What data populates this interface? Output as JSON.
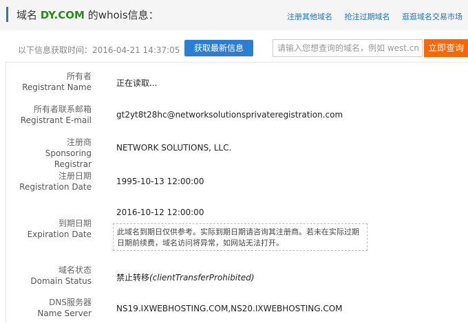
{
  "header": {
    "title_prefix": "域名",
    "domain": "DY.COM",
    "title_suffix": "的whois信息：",
    "links": [
      "注册其他域名",
      "抢注过期域名",
      "逛逛域名交易市场"
    ]
  },
  "toolbar": {
    "fetch_time": "以下信息获取时间：2016-04-21 14:37:05",
    "refresh_label": "获取最新信息",
    "search_placeholder": "请输入您想查询的域名，例如 west.cn",
    "search_button": "立即查询"
  },
  "records": {
    "registrant": {
      "cn": "所有者",
      "en": "Registrant Name",
      "value": "正在读取..."
    },
    "email": {
      "cn": "所有者联系邮箱",
      "en": "Registrant E-mail",
      "value": "gt2yt8t28hc@networksolutionsprivateregistration.com"
    },
    "registrar": {
      "cn": "注册商",
      "en": "Sponsoring Registrar",
      "value": "NETWORK SOLUTIONS, LLC."
    },
    "created": {
      "cn": "注册日期",
      "en": "Registration Date",
      "value": "1995-10-13 12:00:00"
    },
    "expires": {
      "cn": "到期日期",
      "en": "Expiration Date",
      "value": "2016-10-12 12:00:00",
      "note": "此域名到期日仅供参考。实际到期日期请咨询其注册商。若未在实际过期日期前续费，域名访问将异常，如网站无法打开。"
    },
    "status": {
      "cn": "域名状态",
      "en": "Domain Status",
      "value_cn": "禁止转移",
      "value_en": "(clientTransferProhibited)"
    },
    "dns": {
      "cn": "DNS服务器",
      "en": "Name Server",
      "value": "NS19.IXWEBHOSTING.COM,NS20.IXWEBHOSTING.COM"
    }
  },
  "colors": {
    "accent": "#1a7ac4",
    "domain": "#2b8a1e",
    "search_button": "#ff6600",
    "refresh_button": "#2a7fd4"
  }
}
